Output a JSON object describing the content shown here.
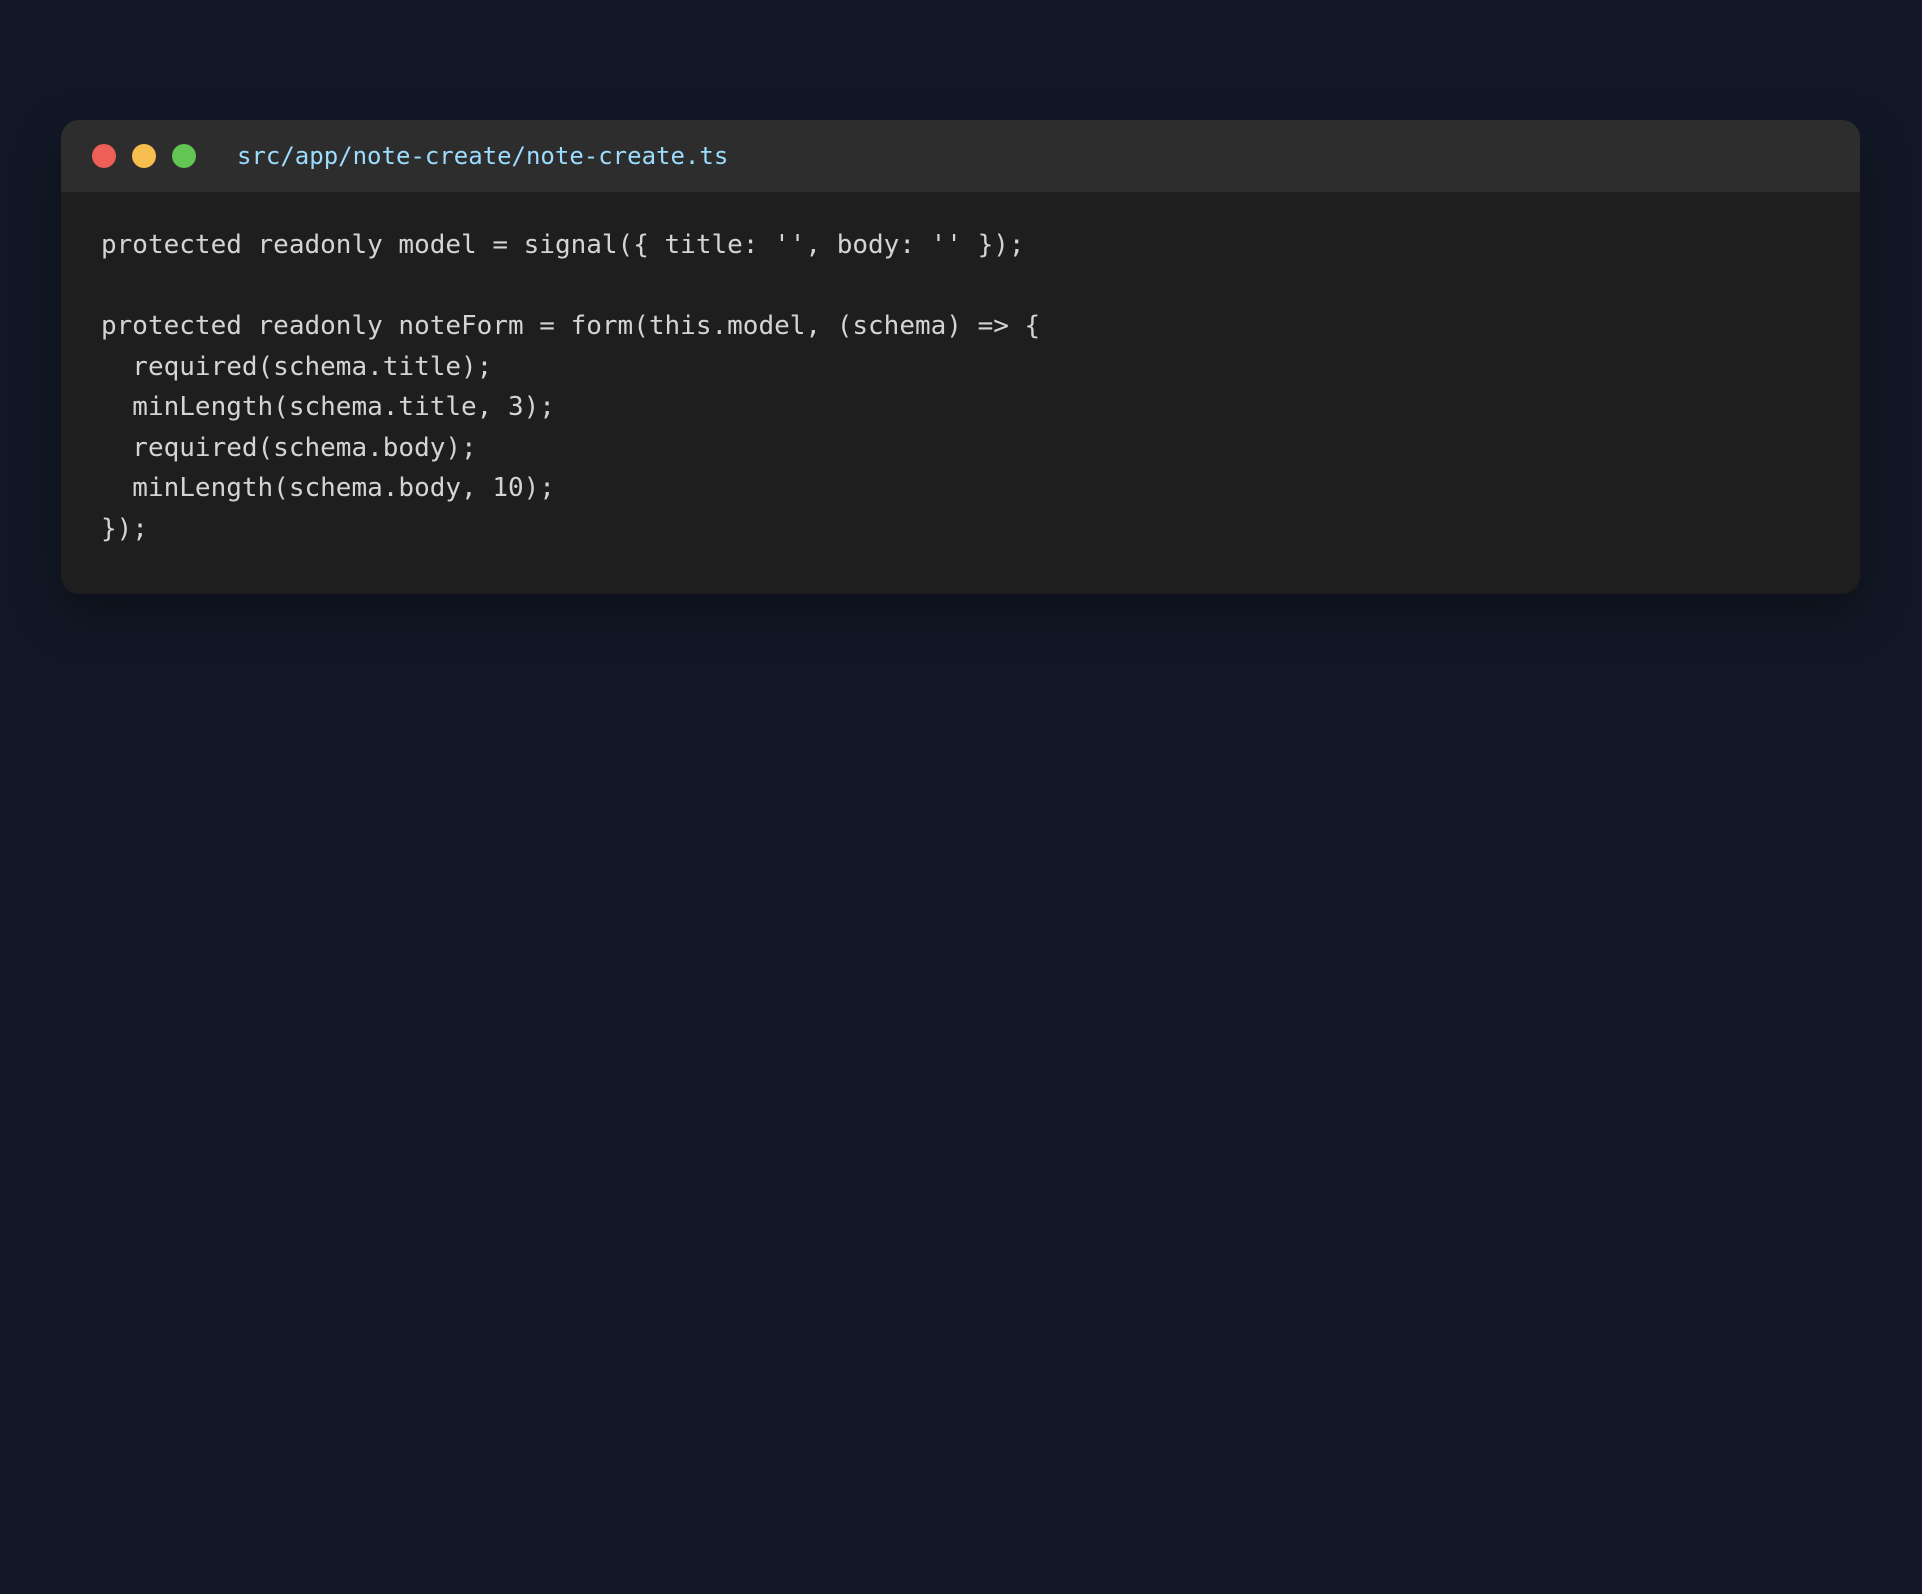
{
  "window": {
    "file_path": "src/app/note-create/note-create.ts",
    "controls": [
      {
        "name": "close",
        "color": "#ed5f57"
      },
      {
        "name": "minimize",
        "color": "#f5be4f"
      },
      {
        "name": "maximize",
        "color": "#62c554"
      }
    ]
  },
  "code": {
    "lines": [
      "protected readonly model = signal({ title: '', body: '' });",
      "",
      "protected readonly noteForm = form(this.model, (schema) => {",
      "  required(schema.title);",
      "  minLength(schema.title, 3);",
      "  required(schema.body);",
      "  minLength(schema.body, 10);",
      "});"
    ]
  },
  "colors": {
    "page_background": "#121826",
    "window_background": "#1e1e1e",
    "titlebar_background": "#2d2d2d",
    "file_path_text": "#9cdcfe",
    "code_text": "#d4d4d4"
  }
}
